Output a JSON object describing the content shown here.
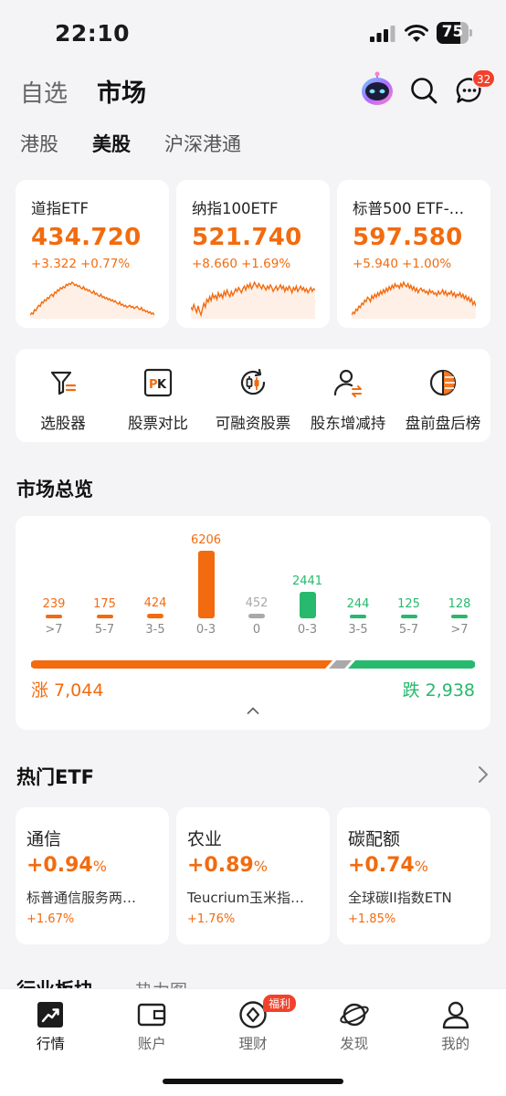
{
  "status_bar": {
    "time": "22:10",
    "battery": "75",
    "battery_level": 0.75
  },
  "header": {
    "tabs": [
      {
        "label": "自选",
        "active": false
      },
      {
        "label": "市场",
        "active": true
      }
    ],
    "message_badge": "32",
    "icons": {
      "assistant": "robot-assistant-icon",
      "search": "search-icon",
      "messages": "chat-bubble-icon"
    }
  },
  "market_tabs": [
    {
      "label": "港股",
      "active": false
    },
    {
      "label": "美股",
      "active": true
    },
    {
      "label": "沪深港通",
      "active": false
    }
  ],
  "index_cards": [
    {
      "name": "道指ETF",
      "price": "434.720",
      "change": "+3.322",
      "change_pct": "+0.77%",
      "spark": [
        5,
        7,
        6,
        10,
        9,
        12,
        14,
        13,
        17,
        16,
        19,
        18,
        21,
        20,
        23,
        24,
        22,
        26,
        25,
        28,
        27,
        30,
        29,
        31,
        30,
        33,
        32,
        34,
        33,
        35,
        34,
        32,
        33,
        31,
        32,
        30,
        29,
        31,
        28,
        29,
        27,
        28,
        26,
        25,
        27,
        24,
        25,
        23,
        22,
        24,
        21,
        22,
        20,
        21,
        19,
        20,
        18,
        19,
        17,
        18,
        16,
        15,
        17,
        14,
        15,
        13,
        14,
        12,
        13,
        14,
        12,
        13,
        11,
        12,
        13,
        11,
        10,
        12,
        9,
        10,
        8,
        9,
        7,
        8,
        6,
        7,
        5
      ]
    },
    {
      "name": "纳指100ETF",
      "price": "521.740",
      "change": "+8.660",
      "change_pct": "+1.69%",
      "spark": [
        12,
        10,
        14,
        11,
        8,
        13,
        9,
        6,
        11,
        15,
        12,
        18,
        16,
        20,
        17,
        22,
        19,
        21,
        18,
        23,
        20,
        22,
        19,
        24,
        21,
        25,
        22,
        20,
        24,
        21,
        23,
        26,
        24,
        27,
        25,
        23,
        26,
        28,
        25,
        29,
        27,
        30,
        26,
        28,
        31,
        29,
        27,
        30,
        28,
        26,
        29,
        27,
        25,
        28,
        26,
        29,
        27,
        24,
        26,
        28,
        25,
        27,
        29,
        26,
        28,
        24,
        27,
        25,
        28,
        26,
        23,
        27,
        25,
        28,
        24,
        26,
        28,
        25,
        27,
        24,
        26,
        23,
        25,
        27,
        24,
        26,
        25
      ]
    },
    {
      "name": "标普500 ETF-…",
      "price": "597.580",
      "change": "+5.940",
      "change_pct": "+1.00%",
      "spark": [
        10,
        12,
        11,
        14,
        13,
        16,
        15,
        18,
        17,
        20,
        19,
        22,
        21,
        19,
        23,
        21,
        24,
        22,
        25,
        23,
        26,
        24,
        27,
        25,
        28,
        26,
        29,
        27,
        30,
        28,
        31,
        29,
        30,
        28,
        31,
        29,
        32,
        30,
        29,
        31,
        28,
        30,
        27,
        29,
        26,
        28,
        25,
        27,
        28,
        26,
        27,
        25,
        26,
        24,
        27,
        25,
        26,
        24,
        25,
        23,
        26,
        24,
        25,
        27,
        24,
        26,
        23,
        25,
        24,
        26,
        23,
        25,
        22,
        24,
        23,
        25,
        22,
        24,
        21,
        23,
        20,
        22,
        19,
        21,
        17,
        19,
        16
      ]
    }
  ],
  "tools": [
    {
      "label": "选股器",
      "icon": "stock-filter-icon"
    },
    {
      "label": "股票对比",
      "icon": "pk-compare-icon"
    },
    {
      "label": "可融资股票",
      "icon": "margin-candlestick-icon"
    },
    {
      "label": "股东增减持",
      "icon": "shareholder-icon"
    },
    {
      "label": "盘前盘后榜",
      "icon": "pre-post-market-icon"
    }
  ],
  "market_overview": {
    "title": "市场总览",
    "up_label": "涨 7,044",
    "down_label": "跌 2,938",
    "up_count": 7044,
    "flat_count": 452,
    "down_count": 2938
  },
  "chart_data": {
    "type": "bar",
    "title": "市场总览",
    "categories": [
      ">7",
      "5-7",
      "3-5",
      "0-3",
      "0",
      "0-3",
      "3-5",
      "5-7",
      ">7"
    ],
    "values": [
      239,
      175,
      424,
      6206,
      452,
      2441,
      244,
      125,
      128
    ],
    "value_labels": [
      "239",
      "175",
      "424",
      "6206",
      "452",
      "2441",
      "244",
      "125",
      "128"
    ],
    "colors": [
      "#f26b0f",
      "#f26b0f",
      "#f26b0f",
      "#f26b0f",
      "#a9a9a9",
      "#27b96d",
      "#27b96d",
      "#27b96d",
      "#27b96d"
    ],
    "ylim": [
      0,
      6206
    ]
  },
  "hot_etf": {
    "title": "热门ETF",
    "items": [
      {
        "name": "通信",
        "pct": "+0.94",
        "pct_unit": "%",
        "sub_name": "标普通信服务两…",
        "sub_change": "+1.67%"
      },
      {
        "name": "农业",
        "pct": "+0.89",
        "pct_unit": "%",
        "sub_name": "Teucrium玉米指…",
        "sub_change": "+1.76%"
      },
      {
        "name": "碳配额",
        "pct": "+0.74",
        "pct_unit": "%",
        "sub_name": "全球碳II指数ETN",
        "sub_change": "+1.85%"
      }
    ]
  },
  "next_section": {
    "title": "行业板块",
    "subtitle": "热力图"
  },
  "bottom_nav": [
    {
      "label": "行情",
      "icon": "trend-chart-icon",
      "active": true
    },
    {
      "label": "账户",
      "icon": "wallet-icon",
      "active": false
    },
    {
      "label": "理财",
      "icon": "wealth-icon",
      "active": false,
      "badge": "福利"
    },
    {
      "label": "发现",
      "icon": "planet-icon",
      "active": false
    },
    {
      "label": "我的",
      "icon": "profile-icon",
      "active": false
    }
  ],
  "colors": {
    "up": "#f26b0f",
    "down": "#27b96d",
    "flat": "#a9a9a9",
    "badge": "#f2412b"
  }
}
